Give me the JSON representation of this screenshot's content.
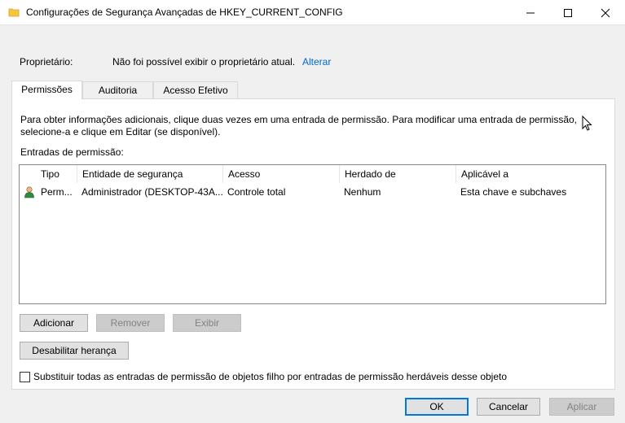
{
  "window": {
    "title": "Configurações de Segurança Avançadas de HKEY_CURRENT_CONFIG",
    "icon": "folder-icon"
  },
  "owner": {
    "label": "Proprietário:",
    "value": "Não foi possível exibir o proprietário atual.",
    "change_link": "Alterar"
  },
  "tabs": [
    {
      "label": "Permissões",
      "active": true
    },
    {
      "label": "Auditoria",
      "active": false
    },
    {
      "label": "Acesso Efetivo",
      "active": false
    }
  ],
  "info_text": "Para obter informações adicionais, clique duas vezes em uma entrada de permissão. Para modificar uma entrada de permissão, selecione-a e clique em Editar (se disponível).",
  "entries_label": "Entradas de permissão:",
  "table": {
    "columns": [
      "Tipo",
      "Entidade de segurança",
      "Acesso",
      "Herdado de",
      "Aplicável a"
    ],
    "rows": [
      {
        "icon": "user-icon",
        "type": "Perm...",
        "principal": "Administrador (DESKTOP-43A...",
        "access": "Controle total",
        "inherited": "Nenhum",
        "applies": "Esta chave e subchaves"
      }
    ]
  },
  "buttons": {
    "add": "Adicionar",
    "remove": "Remover",
    "view": "Exibir",
    "disable_inheritance": "Desabilitar herança",
    "ok": "OK",
    "cancel": "Cancelar",
    "apply": "Aplicar"
  },
  "checkbox": {
    "label": "Substituir todas as entradas de permissão de objetos filho por entradas de permissão herdáveis desse objeto",
    "checked": false
  },
  "colors": {
    "accent": "#0078d7",
    "link": "#0066cc"
  }
}
